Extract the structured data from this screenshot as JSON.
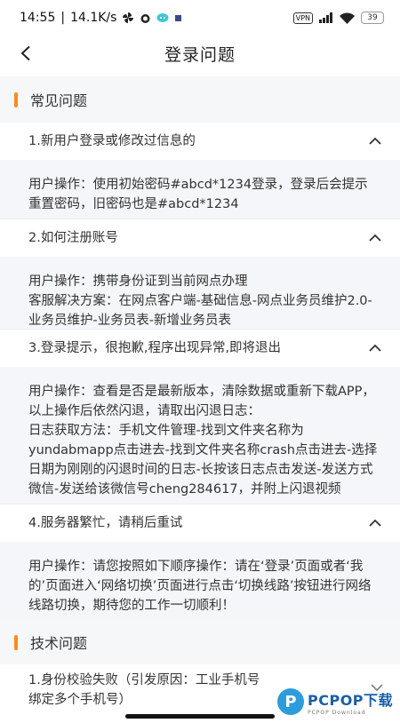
{
  "status_bar": {
    "time": "14:55",
    "speed": "14.1K/s",
    "vpn": "VPN",
    "battery": "39"
  },
  "header": {
    "title": "登录问题"
  },
  "sections": [
    {
      "title": "常见问题"
    },
    {
      "title": "技术问题"
    }
  ],
  "faq": [
    {
      "question": "1.新用户登录或修改过信息的",
      "answer": [
        "用户操作：使用初始密码#abcd*1234登录，登录后会提示重置密码，旧密码也是#abcd*1234"
      ]
    },
    {
      "question": "2.如何注册账号",
      "answer": [
        "用户操作：携带身份证到当前网点办理",
        "客服解决方案：在网点客户端-基础信息-网点业务员维护2.0-业务员维护-业务员表-新增业务员表"
      ]
    },
    {
      "question": "3.登录提示，很抱歉,程序出现异常,即将退出",
      "answer": [
        "用户操作：查看是否是最新版本，清除数据或重新下载APP，以上操作后依然闪退，请取出闪退日志：",
        "日志获取方法：手机文件管理-找到文件夹名称为yundabmapp点击进去-找到文件夹名称crash点击进去-选择日期为刚刚的闪退时间的日志-长按该日志点击发送-发送方式微信-发送给该微信号cheng284617，并附上闪退视频"
      ]
    },
    {
      "question": "4.服务器繁忙，请稍后重试",
      "answer": [
        "用户操作：请您按照如下顺序操作：请在‘登录’页面或者‘我的’页面进入‘网络切换’页面进行点击‘切换线路’按钮进行网络线路切换，期待您的工作一切顺利！"
      ]
    }
  ],
  "tech_faq": [
    {
      "question": "1.身份校验失败（引发原因：工业手机号绑定多个手机号）"
    }
  ],
  "watermark": {
    "title": "PCPOP下载",
    "sub": "PCPOP Download"
  }
}
